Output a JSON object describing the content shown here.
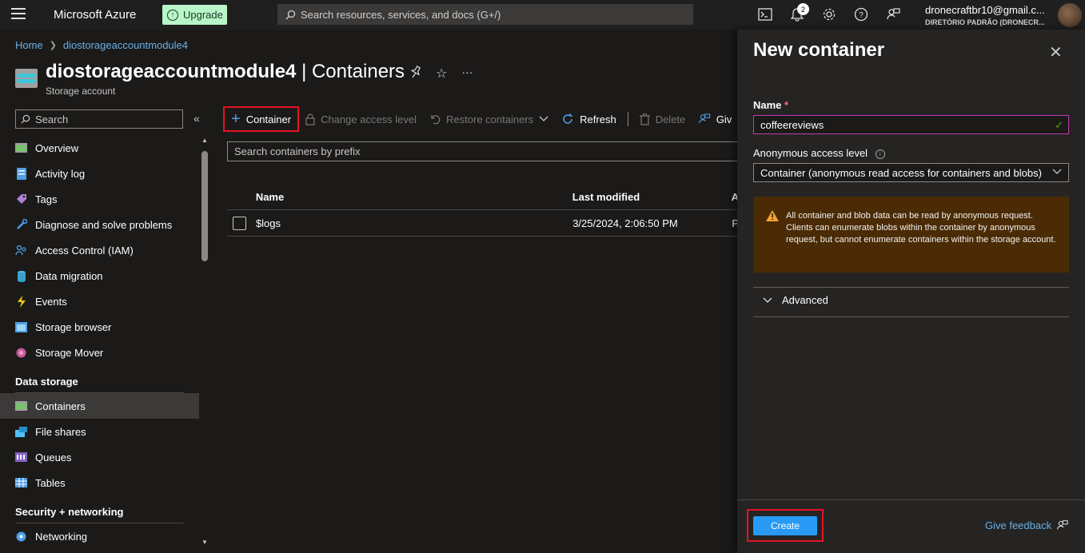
{
  "topbar": {
    "brand": "Microsoft Azure",
    "upgrade_label": "Upgrade",
    "search_placeholder": "Search resources, services, and docs (G+/)",
    "notification_count": "2",
    "account_email": "dronecraftbr10@gmail.c...",
    "account_directory": "DIRETÓRIO PADRÃO (DRONECR..."
  },
  "breadcrumb": [
    "Home",
    "diostorageaccountmodule4"
  ],
  "header": {
    "resource_name": "diostorageaccountmodule4",
    "section": "| Containers",
    "subtitle": "Storage account",
    "ellipsis": "···"
  },
  "nav": {
    "search_placeholder": "Search",
    "collapse": "«",
    "items": [
      {
        "label": "Overview",
        "icon": "overview-icon",
        "color": "#6ccb5f"
      },
      {
        "label": "Activity log",
        "icon": "activity-log-icon",
        "color": "#4f9ee8"
      },
      {
        "label": "Tags",
        "icon": "tag-icon",
        "color": "#b180d7"
      },
      {
        "label": "Diagnose and solve problems",
        "icon": "wrench-icon",
        "color": "#4f9ee8"
      },
      {
        "label": "Access Control (IAM)",
        "icon": "people-icon",
        "color": "#4f9ee8"
      },
      {
        "label": "Data migration",
        "icon": "data-migration-icon",
        "color": "#4fc3f7"
      },
      {
        "label": "Events",
        "icon": "lightning-icon",
        "color": "#f2c811"
      },
      {
        "label": "Storage browser",
        "icon": "storage-browser-icon",
        "color": "#4f9ee8"
      },
      {
        "label": "Storage Mover",
        "icon": "storage-mover-icon",
        "color": "#c75b9b"
      }
    ],
    "data_storage_title": "Data storage",
    "data_storage_items": [
      {
        "label": "Containers",
        "icon": "containers-icon",
        "color": "#6ccb5f"
      },
      {
        "label": "File shares",
        "icon": "file-shares-icon",
        "color": "#4fc3f7"
      },
      {
        "label": "Queues",
        "icon": "queues-icon",
        "color": "#8661c5"
      },
      {
        "label": "Tables",
        "icon": "tables-icon",
        "color": "#4f9ee8"
      }
    ],
    "security_title": "Security + networking",
    "security_items": [
      {
        "label": "Networking",
        "icon": "networking-icon",
        "color": "#4f9ee8"
      }
    ]
  },
  "toolbar": {
    "container": "Container",
    "change_access": "Change access level",
    "restore": "Restore containers",
    "refresh": "Refresh",
    "delete": "Delete",
    "give": "Giv"
  },
  "containers": {
    "search_placeholder": "Search containers by prefix",
    "columns": [
      "Name",
      "Last modified",
      "A"
    ],
    "rows": [
      {
        "name": "$logs",
        "modified": "3/25/2024, 2:06:50 PM",
        "access": "P"
      }
    ]
  },
  "panel": {
    "title": "New container",
    "name_label": "Name",
    "required_mark": "*",
    "name_value": "coffeereviews",
    "access_label": "Anonymous access level",
    "access_value": "Container (anonymous read access for containers and blobs)",
    "warning": "All container and blob data can be read by anonymous request. Clients can enumerate blobs within the container by anonymous request, but cannot enumerate containers within the storage account.",
    "advanced": "Advanced",
    "create": "Create",
    "feedback": "Give feedback"
  },
  "colors": {
    "accent": "#2899f5",
    "highlight": "#e81123",
    "warning_bg": "#4a2b05",
    "link": "#69afe5"
  }
}
